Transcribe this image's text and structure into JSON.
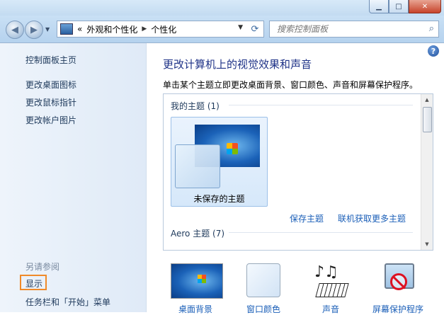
{
  "window": {
    "minimize": "▁",
    "maximize": "□",
    "close": "✕"
  },
  "nav": {
    "back_icon": "back-arrow-icon",
    "forward_icon": "forward-arrow-icon",
    "breadcrumb_prefix": "«",
    "breadcrumb": [
      "外观和个性化",
      "个性化"
    ],
    "search_placeholder": "搜索控制面板"
  },
  "sidebar": {
    "home": "控制面板主页",
    "links": [
      "更改桌面图标",
      "更改鼠标指针",
      "更改帐户图片"
    ],
    "see_also": "另请参阅",
    "see_also_links": [
      "显示",
      "任务栏和「开始」菜单"
    ]
  },
  "main": {
    "heading": "更改计算机上的视觉效果和声音",
    "subtext": "单击某个主题立即更改桌面背景、窗口颜色、声音和屏幕保护程序。",
    "my_themes": "我的主题 (1)",
    "unsaved_theme": "未保存的主题",
    "save_theme": "保存主题",
    "get_more": "联机获取更多主题",
    "aero_themes": "Aero 主题 (7)",
    "bottom": [
      "桌面背景",
      "窗口颜色",
      "声音",
      "屏幕保护程序"
    ]
  },
  "colors": {
    "highlight_border": "#f08a2a",
    "link": "#1b5fb8",
    "heading": "#1e3287"
  }
}
